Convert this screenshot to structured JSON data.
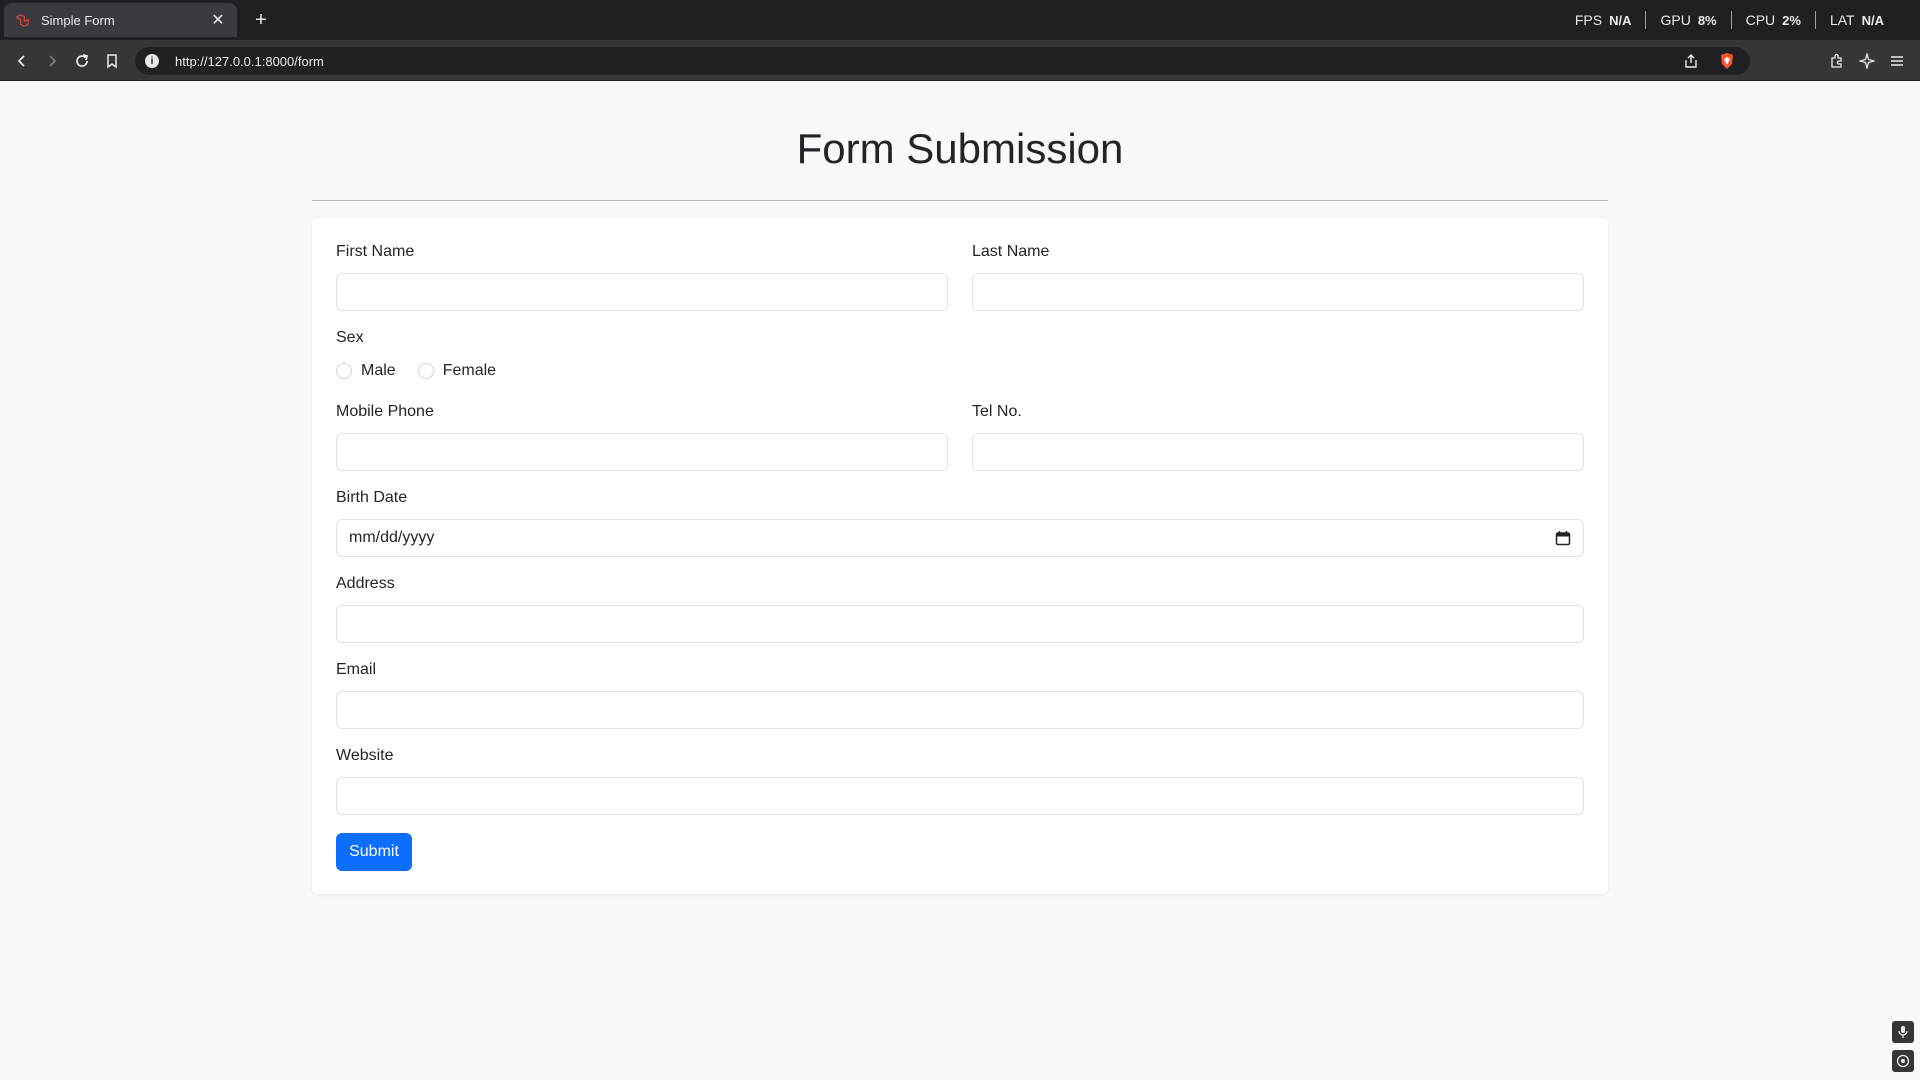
{
  "browser": {
    "tab_title": "Simple Form",
    "url": "http://127.0.0.1:8000/form",
    "perf": [
      {
        "label": "FPS",
        "value": "N/A"
      },
      {
        "label": "GPU",
        "value": "8%"
      },
      {
        "label": "CPU",
        "value": "2%"
      },
      {
        "label": "LAT",
        "value": "N/A"
      }
    ]
  },
  "page": {
    "heading": "Form Submission"
  },
  "form": {
    "first_name": {
      "label": "First Name",
      "value": ""
    },
    "last_name": {
      "label": "Last Name",
      "value": ""
    },
    "sex": {
      "label": "Sex",
      "options": [
        "Male",
        "Female"
      ]
    },
    "mobile_phone": {
      "label": "Mobile Phone",
      "value": ""
    },
    "tel_no": {
      "label": "Tel No.",
      "value": ""
    },
    "birth_date": {
      "label": "Birth Date",
      "placeholder": "mm/dd/yyyy"
    },
    "address": {
      "label": "Address",
      "value": ""
    },
    "email": {
      "label": "Email",
      "value": ""
    },
    "website": {
      "label": "Website",
      "value": ""
    },
    "submit_label": "Submit"
  },
  "colors": {
    "primary": "#0d6efd",
    "page_bg": "#f8f9fa",
    "chrome_dark": "#1f2024"
  }
}
